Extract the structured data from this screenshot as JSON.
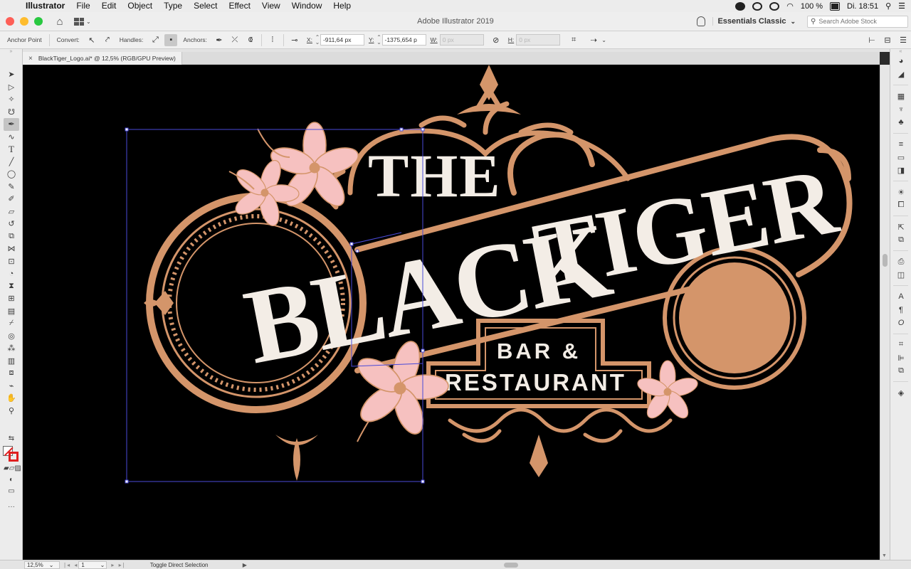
{
  "menubar": {
    "app": "Illustrator",
    "items": [
      "File",
      "Edit",
      "Object",
      "Type",
      "Select",
      "Effect",
      "View",
      "Window",
      "Help"
    ],
    "battery": "100 %",
    "clock": "Di. 18:51"
  },
  "titlebar": {
    "title": "Adobe Illustrator 2019",
    "workspace": "Essentials Classic",
    "search_placeholder": "Search Adobe Stock"
  },
  "controlbar": {
    "mode_label": "Anchor Point",
    "convert_label": "Convert:",
    "handles_label": "Handles:",
    "anchors_label": "Anchors:",
    "x_label": "X:",
    "x_value": "-911,64 px",
    "y_label": "Y:",
    "y_value": "-1375,654 p",
    "w_label": "W:",
    "w_value": "0 px",
    "h_label": "H:",
    "h_value": "0 px"
  },
  "document": {
    "tab_title": "BlackTiger_Logo.ai* @ 12,5% (RGB/GPU Preview)"
  },
  "artwork": {
    "line_the": "THE",
    "line_black": "BLACK",
    "line_tiger": "TIGER",
    "line_bar": "BAR &",
    "line_restaurant": "RESTAURANT",
    "colors": {
      "background": "#000000",
      "ornament": "#d4956a",
      "lettering": "#f3ede6",
      "flower": "#f6c1c0",
      "selection": "#4a4ad8"
    }
  },
  "statusbar": {
    "zoom": "12,5%",
    "artboard": "1",
    "status": "Toggle Direct Selection"
  },
  "icons": {
    "tools": [
      "selection-icon",
      "direct-selection-icon",
      "magic-wand-icon",
      "lasso-icon",
      "pen-icon",
      "curvature-icon",
      "type-icon",
      "line-icon",
      "ellipse-icon",
      "paintbrush-icon",
      "shaper-icon",
      "eraser-icon",
      "rotate-icon",
      "scale-icon",
      "width-icon",
      "free-transform-icon",
      "shape-builder-icon",
      "perspective-icon",
      "mesh-icon",
      "gradient-icon",
      "eyedropper-icon",
      "blend-icon",
      "symbol-sprayer-icon",
      "column-graph-icon",
      "artboard-icon",
      "slice-icon",
      "hand-icon",
      "zoom-icon"
    ],
    "dock": [
      "color-icon",
      "color-guide-icon",
      "swatches-icon",
      "brushes-icon",
      "symbols-icon",
      "stroke-icon",
      "gradient-panel-icon",
      "transparency-icon",
      "appearance-icon",
      "graphic-styles-icon",
      "export-icon",
      "links-icon",
      "image-trace-icon",
      "libraries-icon",
      "character-icon",
      "paragraph-icon",
      "opentype-icon",
      "transform-icon",
      "align-icon",
      "pathfinder-icon",
      "layers-icon"
    ]
  }
}
